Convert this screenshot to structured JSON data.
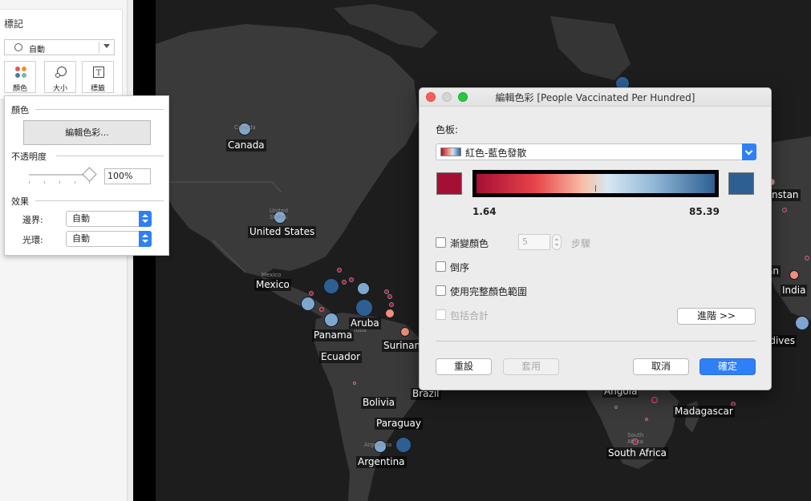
{
  "marks_panel": {
    "title": "標記",
    "mark_type": "自動",
    "buttons": [
      {
        "label": "顏色",
        "icon": "color-dots-icon"
      },
      {
        "label": "大小",
        "icon": "size-icon"
      },
      {
        "label": "標籤",
        "icon": "label-icon"
      }
    ]
  },
  "color_popover": {
    "color_heading": "顏色",
    "edit_colors_button": "編輯色彩...",
    "opacity_heading": "不透明度",
    "opacity_value": "100%",
    "opacity_level": 1.0,
    "effects_heading": "效果",
    "border_label": "邊界:",
    "border_value": "自動",
    "halo_label": "光環:",
    "halo_value": "自動"
  },
  "map": {
    "labels": {
      "canada": "Canada",
      "united_states": "United States",
      "mexico": "Mexico",
      "panama": "Panama",
      "aruba": "Aruba",
      "ecuador": "Ecuador",
      "surinam": "Surinam",
      "bolivia": "Bolivia",
      "brazil": "Brazil",
      "paraguay": "Paraguay",
      "argentina": "Argentina",
      "angola": "Angola",
      "madagascar": "Madagascar",
      "south_africa": "South Africa",
      "nstan": "nstan",
      "india": "India",
      "ldives": "ldives",
      "an": "an"
    },
    "basemap_labels": {
      "canada": "Canada",
      "united_states": "United States",
      "mexico": "Mexico",
      "aruba": "Aruba",
      "argentina": "Argentina",
      "south_africa": "South Africa"
    },
    "colors": {
      "background": "#1d1d1d",
      "land": "#3a3a3a",
      "high": "#2d5f93",
      "mid_blue": "#7ea7d0",
      "low": "#a50f34",
      "mid_red": "#f28e7f"
    }
  },
  "dialog": {
    "title": "編輯色彩 [People Vaccinated Per Hundred]",
    "palette_label": "色板:",
    "palette_value": "紅色-藍色發散",
    "range_min": "1.64",
    "range_max": "85.39",
    "start_color": "#a50f34",
    "end_color": "#2d5f93",
    "stepped_label": "漸變顏色",
    "steps_value": "5",
    "steps_label": "步驟",
    "reversed_label": "倒序",
    "full_range_label": "使用完整顏色範圍",
    "include_totals_label": "包括合計",
    "advanced_button": "進階 >>",
    "reset_button": "重設",
    "apply_button": "套用",
    "cancel_button": "取消",
    "ok_button": "確定"
  }
}
